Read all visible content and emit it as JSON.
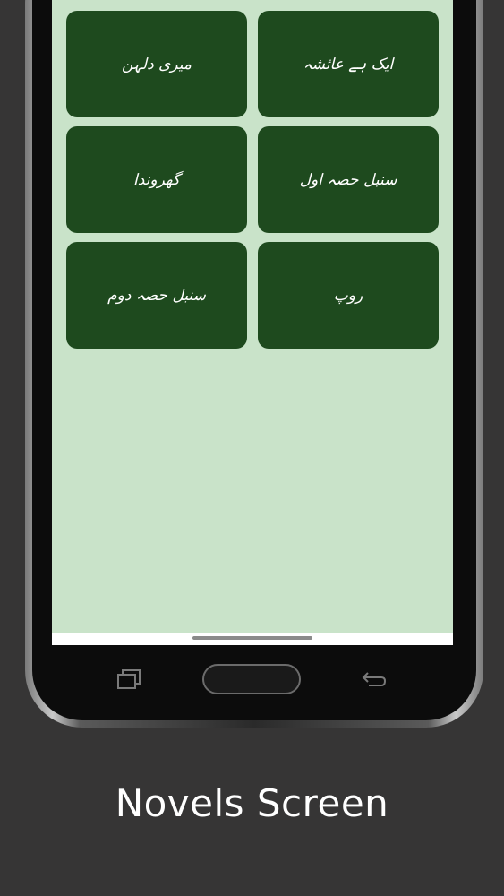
{
  "novels": [
    {
      "title": "میری دلہن"
    },
    {
      "title": "ایک ہے عائشہ"
    },
    {
      "title": "گھروندا"
    },
    {
      "title": "سنبل حصہ اول"
    },
    {
      "title": "سنبل حصہ دوم"
    },
    {
      "title": "روپ"
    }
  ],
  "caption": "Novels Screen",
  "colors": {
    "background": "#363535",
    "screen": "#c9e3c9",
    "card": "#1e4a1e",
    "card_text": "#ffffff"
  },
  "icons": {
    "recent_apps": "recent-apps-icon",
    "home": "home-button",
    "back": "back-icon"
  }
}
